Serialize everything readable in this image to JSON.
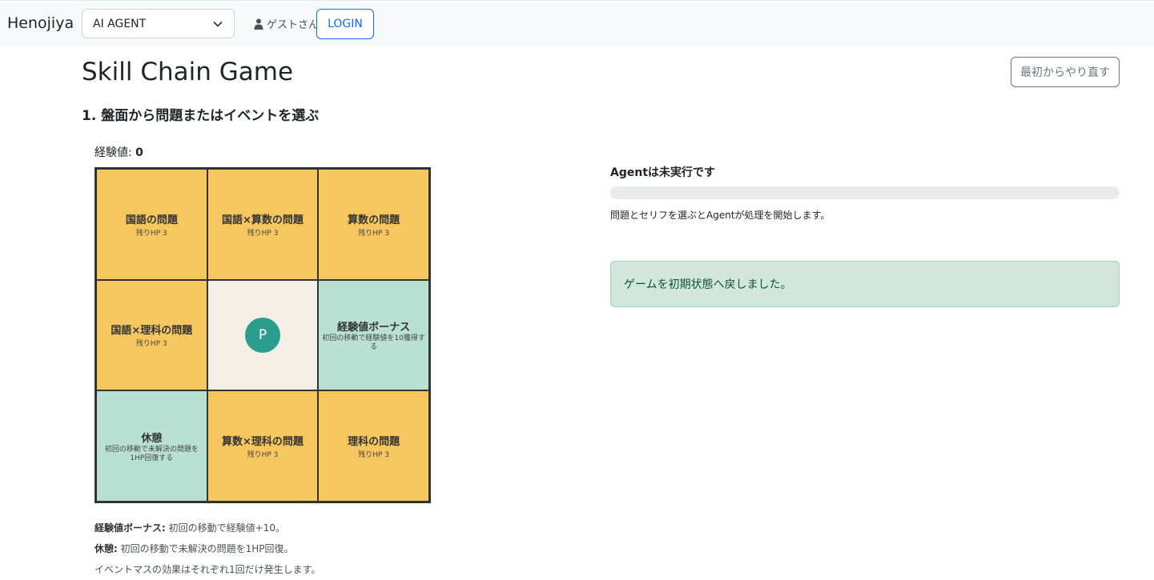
{
  "navbar": {
    "brand": "Henojiya",
    "agent_select": {
      "value": "AI AGENT"
    },
    "user": "ゲストさん",
    "login_label": "LOGIN"
  },
  "header": {
    "title": "Skill Chain Game",
    "reset_label": "最初からやり直す",
    "step": "1. 盤面から問題またはイベントを選ぶ"
  },
  "experience": {
    "label": "経験値:",
    "value": "0"
  },
  "board": {
    "cells": [
      {
        "type": "problem",
        "title": "国語の問題",
        "sub": "残りHP 3"
      },
      {
        "type": "problem",
        "title": "国語×算数の問題",
        "sub": "残りHP 3"
      },
      {
        "type": "problem",
        "title": "算数の問題",
        "sub": "残りHP 3"
      },
      {
        "type": "problem",
        "title": "国語×理科の問題",
        "sub": "残りHP 3"
      },
      {
        "type": "player",
        "title": "P",
        "sub": ""
      },
      {
        "type": "event",
        "title": "経験値ボーナス",
        "sub": "初回の移動で経験値を10獲得する"
      },
      {
        "type": "event",
        "title": "休憩",
        "sub": "初回の移動で未解決の問題を1HP回復する"
      },
      {
        "type": "problem",
        "title": "算数×理科の問題",
        "sub": "残りHP 3"
      },
      {
        "type": "problem",
        "title": "理科の問題",
        "sub": "残りHP 3"
      }
    ]
  },
  "notes": {
    "bonus_label": "経験値ボーナス:",
    "bonus_text": " 初回の移動で経験値+10。",
    "rest_label": "休憩:",
    "rest_text": " 初回の移動で未解決の問題を1HP回復。",
    "note": "イベントマスの効果はそれぞれ1回だけ発生します。"
  },
  "agent": {
    "status": "Agentは未実行です",
    "progress": 0,
    "description": "問題とセリフを選ぶとAgentが処理を開始します。"
  },
  "alert": {
    "message": "ゲームを初期状態へ戻しました。"
  },
  "colors": {
    "problem": "#f6c65f",
    "event": "#b8e0d3",
    "player_cell": "#f3efe7",
    "token": "#2a9d8f",
    "primary": "#0d6efd"
  }
}
